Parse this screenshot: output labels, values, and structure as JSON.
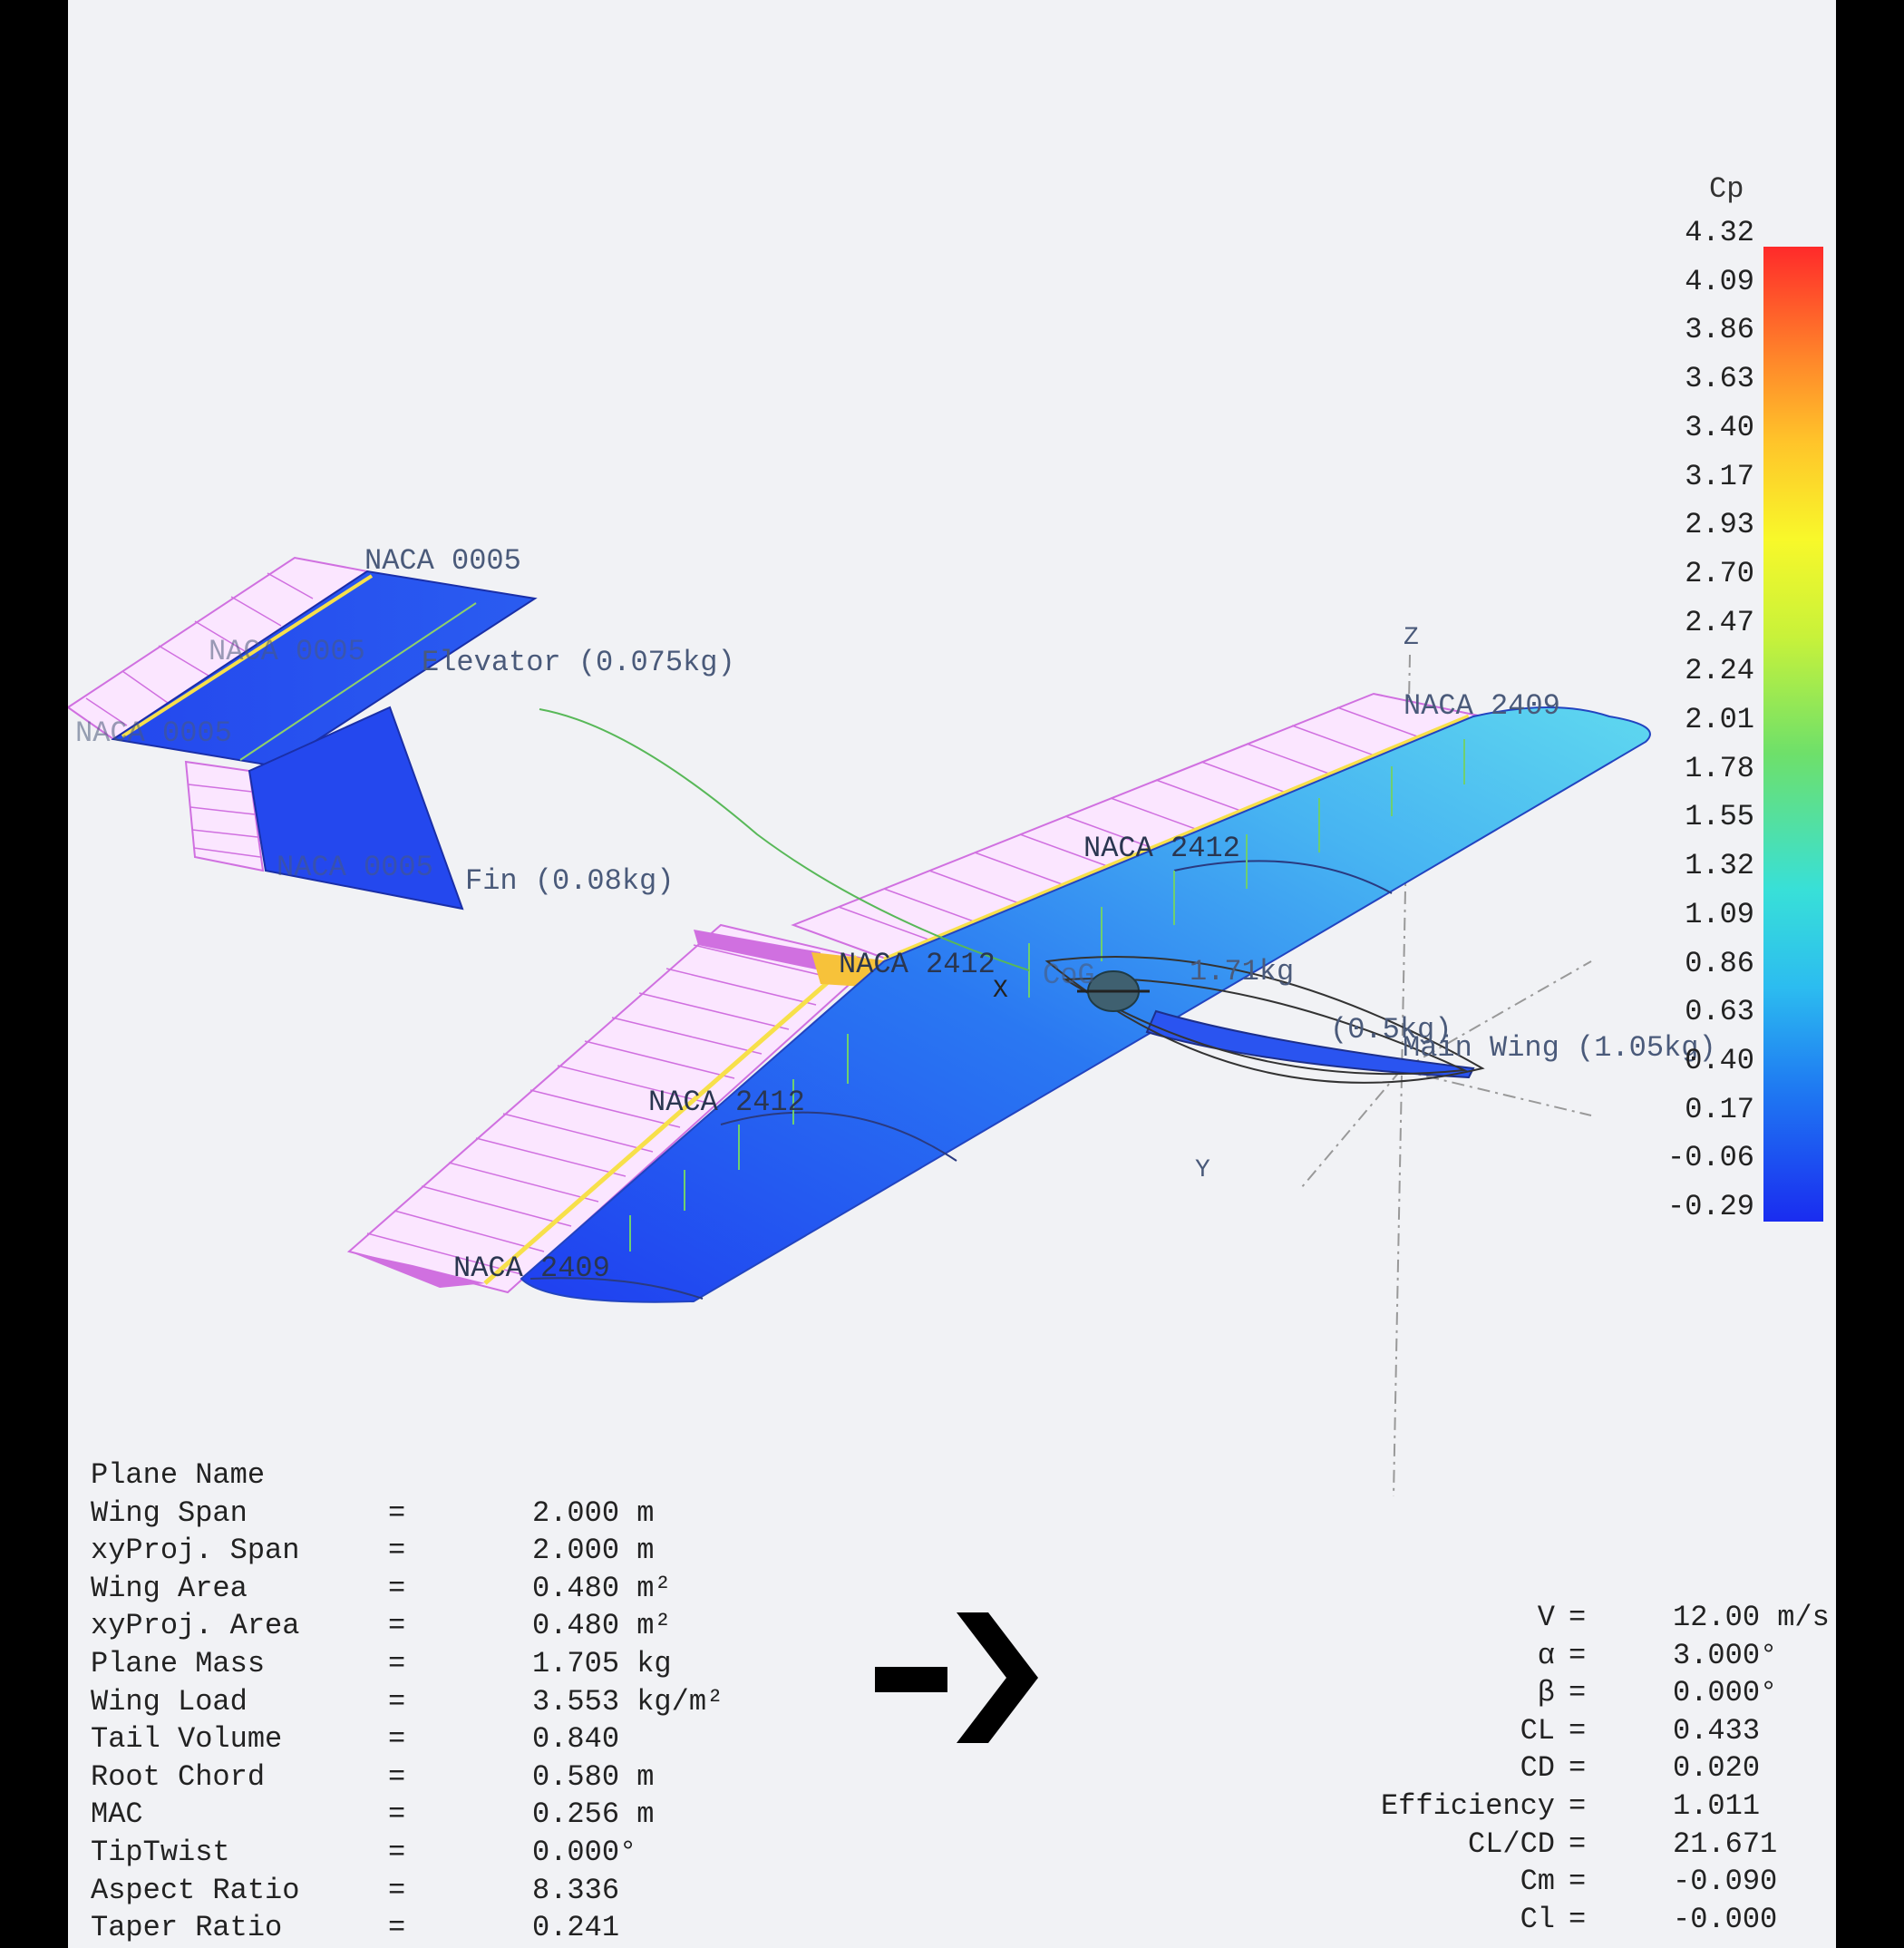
{
  "colorbar": {
    "title": "Cp",
    "ticks": [
      "4.32",
      "4.09",
      "3.86",
      "3.63",
      "3.40",
      "3.17",
      "2.93",
      "2.70",
      "2.47",
      "2.24",
      "2.01",
      "1.78",
      "1.55",
      "1.32",
      "1.09",
      "0.86",
      "0.63",
      "0.40",
      "0.17",
      "-0.06",
      "-0.29"
    ]
  },
  "labels": {
    "naca_0005_top": "NACA 0005",
    "naca_0005_mid": "NACA 0005",
    "naca_0005_left": "NACA 0005",
    "naca_0005_fin": "NACA 0005",
    "elevator": "Elevator (0.075kg)",
    "fin": "Fin (0.08kg)",
    "naca_2409_tip_right": "NACA 2409",
    "naca_2412_right": "NACA 2412",
    "naca_2412_root": "NACA 2412",
    "naca_2412_left": "NACA 2412",
    "naca_2409_tip_left": "NACA 2409",
    "cog": "CoG",
    "cog_mass": "1.71kg",
    "fuselage_mass": "(0.5kg)",
    "main_wing": "Main Wing (1.05kg)",
    "axis_z": "Z",
    "axis_y": "Y",
    "axis_x": "X"
  },
  "plane_props": [
    {
      "key": "Plane Name",
      "eq": "",
      "val": ""
    },
    {
      "key": "Wing Span",
      "eq": "=",
      "val": "2.000 m"
    },
    {
      "key": "xyProj. Span",
      "eq": "=",
      "val": "2.000 m"
    },
    {
      "key": "Wing Area",
      "eq": "=",
      "val": "0.480 m²"
    },
    {
      "key": "xyProj. Area",
      "eq": "=",
      "val": "0.480 m²"
    },
    {
      "key": "Plane Mass",
      "eq": "=",
      "val": "1.705 kg"
    },
    {
      "key": "Wing Load",
      "eq": "=",
      "val": "3.553 kg/m²"
    },
    {
      "key": "Tail Volume",
      "eq": "=",
      "val": "0.840"
    },
    {
      "key": "Root Chord",
      "eq": "=",
      "val": "0.580 m"
    },
    {
      "key": "MAC",
      "eq": "=",
      "val": "0.256 m"
    },
    {
      "key": "TipTwist",
      "eq": "=",
      "val": "0.000°"
    },
    {
      "key": "Aspect Ratio",
      "eq": "=",
      "val": "8.336"
    },
    {
      "key": "Taper Ratio",
      "eq": "=",
      "val": "0.241"
    }
  ],
  "aero_results": [
    {
      "key": "V",
      "eq": "=",
      "val": "12.00 m/s"
    },
    {
      "key": "α",
      "eq": "=",
      "val": "3.000°"
    },
    {
      "key": "β",
      "eq": "=",
      "val": "0.000°"
    },
    {
      "key": "CL",
      "eq": "=",
      "val": "0.433"
    },
    {
      "key": "CD",
      "eq": "=",
      "val": "0.020"
    },
    {
      "key": "Efficiency",
      "eq": "=",
      "val": "1.011"
    },
    {
      "key": "CL/CD",
      "eq": "=",
      "val": "21.671"
    },
    {
      "key": "Cm",
      "eq": "=",
      "val": "-0.090"
    },
    {
      "key": "Cl",
      "eq": "=",
      "val": "-0.000"
    }
  ],
  "colors": {
    "surface_blue": "#2446f0",
    "surface_light": "#5fd0f0",
    "flap_magenta": "#d070e0",
    "flap_yellow": "#f7e04a",
    "background": "#f1f2f5"
  },
  "icons": {
    "next": "chevron-right-arrow-icon"
  }
}
